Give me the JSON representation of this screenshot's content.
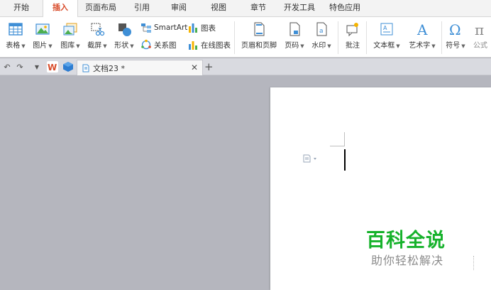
{
  "menu": {
    "tabs": [
      "开始",
      "插入",
      "页面布局",
      "引用",
      "审阅",
      "视图",
      "章节",
      "开发工具",
      "特色应用"
    ],
    "active": "插入"
  },
  "ribbon": {
    "table": "表格",
    "picture": "图片",
    "gallery": "图库",
    "screenshot": "截屏",
    "shapes": "形状",
    "smartart": "SmartArt",
    "chart": "图表",
    "relation": "关系图",
    "online_chart": "在线图表",
    "header_footer": "页眉和页脚",
    "page_number": "页码",
    "watermark": "水印",
    "comment": "批注",
    "textbox": "文本框",
    "wordart": "艺术字",
    "symbol": "符号",
    "formula": "公式"
  },
  "docbar": {
    "tab_label": "文档23 *"
  },
  "overlay": {
    "brand": "百科全说",
    "slogan": "助你轻松解决"
  },
  "colors": {
    "accent": "#d84b2a",
    "brand_green": "#16b22b",
    "workspace": "#b5b6be"
  }
}
